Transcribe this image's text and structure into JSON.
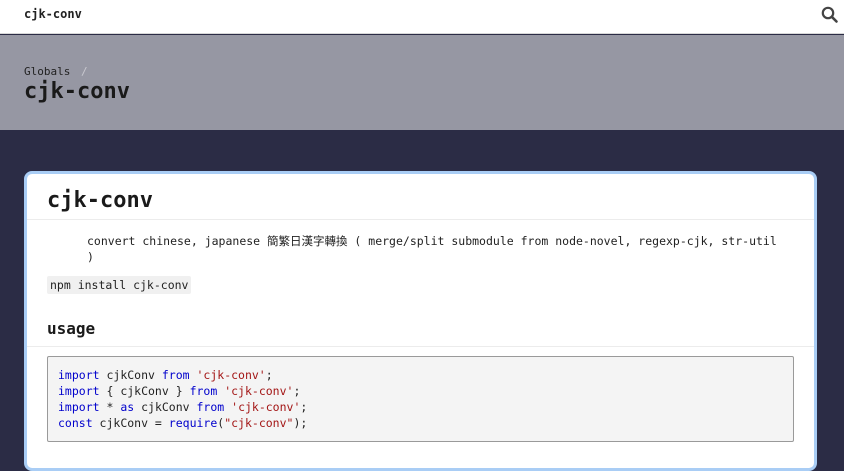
{
  "topbar": {
    "brand": "cjk-conv",
    "search_icon": "search-icon"
  },
  "header": {
    "breadcrumb": "Globals",
    "breadcrumb_separator": "/",
    "title": "cjk-conv"
  },
  "main": {
    "heading": "cjk-conv",
    "description": "convert chinese, japanese 簡繁日漢字轉換 ( merge/split submodule from node-novel, regexp-cjk, str-util )",
    "install_command": "npm install cjk-conv",
    "usage_heading": "usage",
    "code_lines": [
      [
        {
          "t": "import",
          "c": "kw"
        },
        {
          "t": " cjkConv ",
          "c": "plain"
        },
        {
          "t": "from",
          "c": "kw"
        },
        {
          "t": " ",
          "c": "plain"
        },
        {
          "t": "'cjk-conv'",
          "c": "str"
        },
        {
          "t": ";",
          "c": "plain"
        }
      ],
      [
        {
          "t": "import",
          "c": "kw"
        },
        {
          "t": " { cjkConv } ",
          "c": "plain"
        },
        {
          "t": "from",
          "c": "kw"
        },
        {
          "t": " ",
          "c": "plain"
        },
        {
          "t": "'cjk-conv'",
          "c": "str"
        },
        {
          "t": ";",
          "c": "plain"
        }
      ],
      [
        {
          "t": "import",
          "c": "kw"
        },
        {
          "t": " * ",
          "c": "plain"
        },
        {
          "t": "as",
          "c": "kw"
        },
        {
          "t": " cjkConv ",
          "c": "plain"
        },
        {
          "t": "from",
          "c": "kw"
        },
        {
          "t": " ",
          "c": "plain"
        },
        {
          "t": "'cjk-conv'",
          "c": "str"
        },
        {
          "t": ";",
          "c": "plain"
        }
      ],
      [
        {
          "t": "const",
          "c": "kw"
        },
        {
          "t": " cjkConv = ",
          "c": "plain"
        },
        {
          "t": "require",
          "c": "kw"
        },
        {
          "t": "(",
          "c": "plain"
        },
        {
          "t": "\"cjk-conv\"",
          "c": "str"
        },
        {
          "t": ");",
          "c": "plain"
        }
      ]
    ]
  },
  "colors": {
    "topbar_bg": "#ffffff",
    "title_band_bg": "#9697a3",
    "page_bg": "#2b2c45",
    "card_border": "#a9cdf5",
    "keyword": "#0000cc",
    "string": "#a31515"
  }
}
